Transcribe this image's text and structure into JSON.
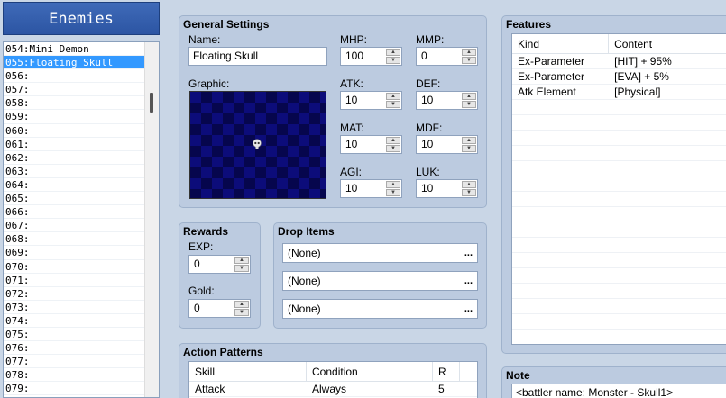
{
  "enemies_panel": {
    "title": "Enemies",
    "items": [
      {
        "label": "054:Mini Demon",
        "selected": false
      },
      {
        "label": "055:Floating Skull",
        "selected": true
      },
      {
        "label": "056:",
        "selected": false
      },
      {
        "label": "057:",
        "selected": false
      },
      {
        "label": "058:",
        "selected": false
      },
      {
        "label": "059:",
        "selected": false
      },
      {
        "label": "060:",
        "selected": false
      },
      {
        "label": "061:",
        "selected": false
      },
      {
        "label": "062:",
        "selected": false
      },
      {
        "label": "063:",
        "selected": false
      },
      {
        "label": "064:",
        "selected": false
      },
      {
        "label": "065:",
        "selected": false
      },
      {
        "label": "066:",
        "selected": false
      },
      {
        "label": "067:",
        "selected": false
      },
      {
        "label": "068:",
        "selected": false
      },
      {
        "label": "069:",
        "selected": false
      },
      {
        "label": "070:",
        "selected": false
      },
      {
        "label": "071:",
        "selected": false
      },
      {
        "label": "072:",
        "selected": false
      },
      {
        "label": "073:",
        "selected": false
      },
      {
        "label": "074:",
        "selected": false
      },
      {
        "label": "075:",
        "selected": false
      },
      {
        "label": "076:",
        "selected": false
      },
      {
        "label": "077:",
        "selected": false
      },
      {
        "label": "078:",
        "selected": false
      },
      {
        "label": "079:",
        "selected": false
      }
    ]
  },
  "general": {
    "title": "General Settings",
    "name_label": "Name:",
    "name_value": "Floating Skull",
    "graphic_label": "Graphic:",
    "mhp_label": "MHP:",
    "mhp": "100",
    "mmp_label": "MMP:",
    "mmp": "0",
    "atk_label": "ATK:",
    "atk": "10",
    "def_label": "DEF:",
    "def": "10",
    "mat_label": "MAT:",
    "mat": "10",
    "mdf_label": "MDF:",
    "mdf": "10",
    "agi_label": "AGI:",
    "agi": "10",
    "luk_label": "LUK:",
    "luk": "10"
  },
  "rewards": {
    "title": "Rewards",
    "exp_label": "EXP:",
    "exp": "0",
    "gold_label": "Gold:",
    "gold": "0"
  },
  "drop_items": {
    "title": "Drop Items",
    "items": [
      "(None)",
      "(None)",
      "(None)"
    ],
    "more_glyph": "..."
  },
  "action_patterns": {
    "title": "Action Patterns",
    "columns": [
      "Skill",
      "Condition",
      "R"
    ],
    "rows": [
      [
        "Attack",
        "Always",
        "5"
      ]
    ]
  },
  "features": {
    "title": "Features",
    "columns": [
      "Kind",
      "Content"
    ],
    "rows": [
      [
        "Ex-Parameter",
        "[HIT] + 95%"
      ],
      [
        "Ex-Parameter",
        "[EVA] + 5%"
      ],
      [
        "Atk Element",
        "[Physical]"
      ]
    ]
  },
  "note": {
    "title": "Note",
    "text": "<battler name: Monster - Skull1>"
  }
}
